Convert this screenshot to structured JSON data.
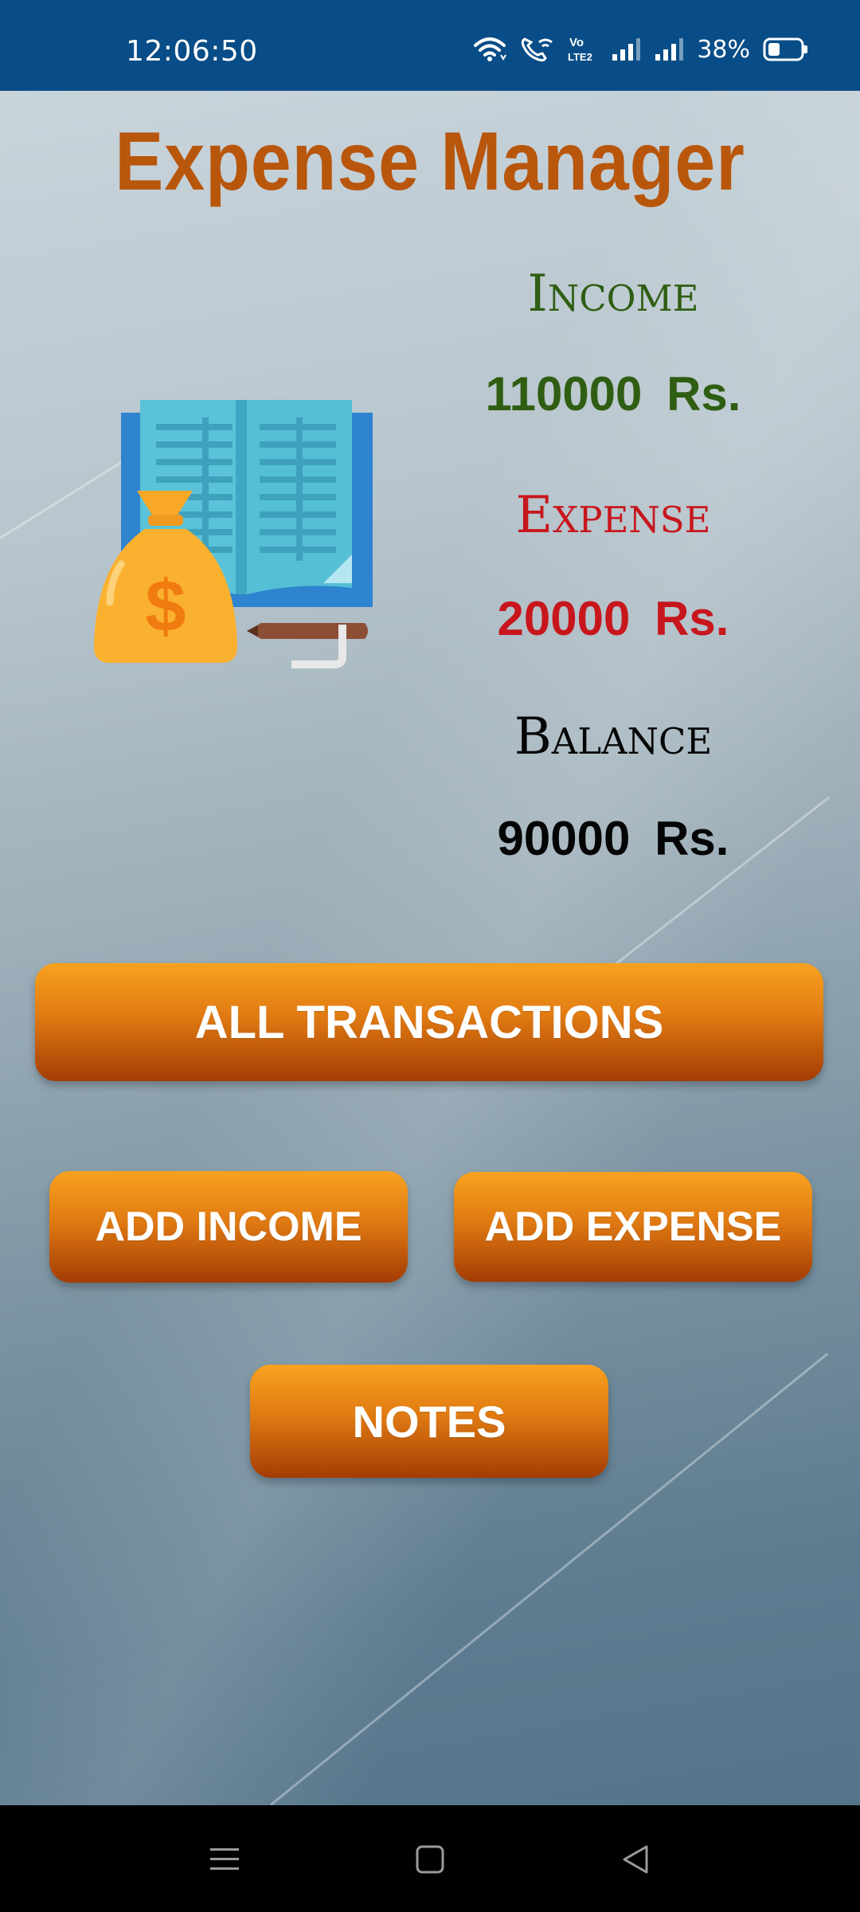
{
  "status_bar": {
    "time": "12:06:50",
    "battery_percent": "38%",
    "battery_level": 0.38,
    "icons": [
      "wifi-icon",
      "wifi-calling-icon",
      "volte-icon",
      "signal-icon",
      "signal-icon",
      "battery-icon"
    ],
    "volte_text_top": "Vo",
    "volte_text_bottom": "LTE2"
  },
  "header": {
    "title": "Expense Manager"
  },
  "summary": {
    "income_label": "Income",
    "income_value": "110000  Rs.",
    "expense_label": "Expense",
    "expense_value": "20000  Rs.",
    "balance_label": "Balance",
    "balance_value": "90000  Rs."
  },
  "illustration": {
    "icon": "ledger-money-bag-icon",
    "symbol": "$"
  },
  "buttons": {
    "all_transactions": "ALL TRANSACTIONS",
    "add_income": "ADD INCOME",
    "add_expense": "ADD EXPENSE",
    "notes": "NOTES"
  },
  "nav_bar": {
    "icons": [
      "menu-icon",
      "home-icon",
      "back-icon"
    ]
  },
  "colors": {
    "status_bar": "#084d87",
    "title": "#b8560c",
    "income": "#2f5e13",
    "expense": "#c8161d",
    "balance": "#050505",
    "button_top": "#f8a21f",
    "button_bottom": "#a33c04"
  }
}
